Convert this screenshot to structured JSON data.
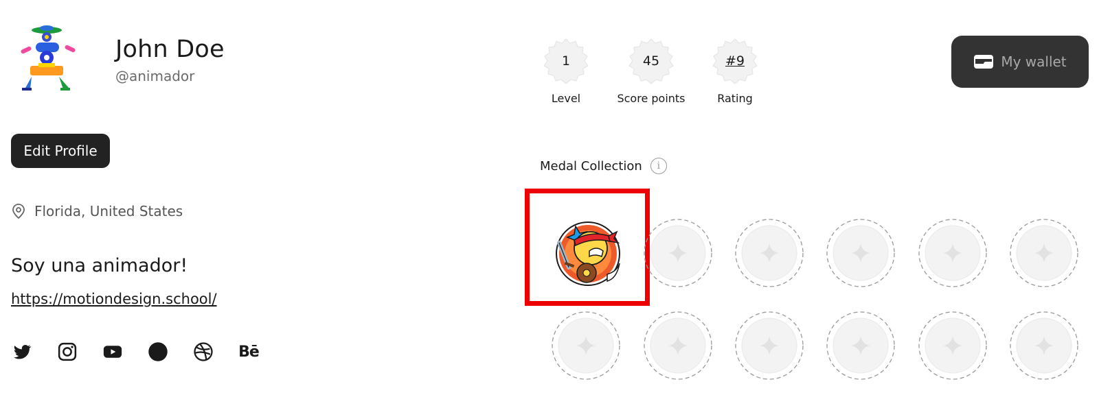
{
  "profile": {
    "name": "John Doe",
    "handle": "@animador",
    "edit_label": "Edit Profile",
    "location": "Florida, United States",
    "bio": "Soy una animador!",
    "website": "https://motiondesign.school/",
    "socials": [
      "twitter-icon",
      "instagram-icon",
      "youtube-icon",
      "circle-icon",
      "dribbble-icon",
      "behance-icon"
    ],
    "behance_text": "Bē"
  },
  "stats": {
    "level_value": "1",
    "level_label": "Level",
    "score_value": "45",
    "score_label": "Score points",
    "rating_value": "#9",
    "rating_label": "Rating"
  },
  "wallet": {
    "label": "My wallet",
    "icon": "wallet-icon"
  },
  "medals": {
    "title": "Medal Collection",
    "info_glyph": "i",
    "earned_count": 1,
    "total_slots": 12
  },
  "colors": {
    "dark_button": "#222222",
    "wallet_button": "#333333",
    "selection_frame": "#ee0000"
  }
}
